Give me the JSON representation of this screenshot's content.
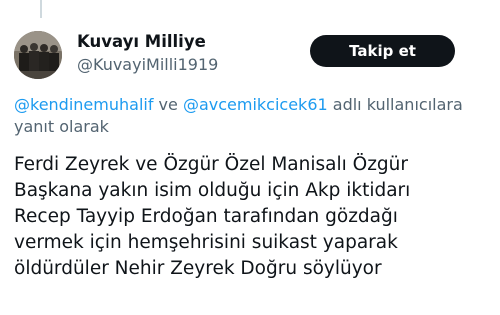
{
  "author": {
    "display_name": "Kuvayı Milliye",
    "handle": "@KuvayiMilli1919",
    "avatar_icon": "group-photo-avatar"
  },
  "follow_button": {
    "label": "Takip et"
  },
  "reply_context": {
    "mention_1": "@kendinemuhalif",
    "connector": " ve ",
    "mention_2": "@avcemikcicek61",
    "suffix": " adlı kullanıcılara",
    "line2": "yanıt olarak"
  },
  "tweet": {
    "text": "Ferdi Zeyrek ve Özgür Özel Manisalı Özgür\nBaşkana yakın isim olduğu için Akp iktidarı\nRecep Tayyip Erdoğan tarafından gözdağı\nvermek için hemşehrisini suikast yaparak\nöldürdüler Nehir Zeyrek Doğru söylüyor"
  },
  "colors": {
    "mention_blue": "#1d9bf0",
    "secondary_text": "#536471",
    "button_bg": "#0f1419"
  }
}
